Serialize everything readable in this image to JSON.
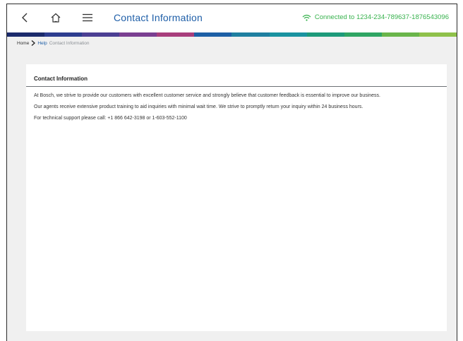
{
  "header": {
    "title": "Contact Information",
    "connection_status": "Connected to 1234-234-789637-1876543096",
    "icons": [
      "back-arrow-icon",
      "home-icon",
      "menu-icon",
      "wifi-icon"
    ]
  },
  "stripe_colors": [
    "#1b2a6b",
    "#2d3d8f",
    "#4b3f93",
    "#7a3f91",
    "#a83e7c",
    "#1d5fa6",
    "#1f7fa0",
    "#1a93a0",
    "#1d9a7a",
    "#2fa563",
    "#6ab54a",
    "#8fc14a"
  ],
  "breadcrumb": {
    "home": "Home",
    "separator": ">",
    "help": "Help",
    "current": "Contact Information"
  },
  "card": {
    "title": "Contact Information",
    "paragraphs": [
      "At Bosch, we strive to provide our customers with excellent customer service and strongly believe that customer feedback is essential to improve our business.",
      "Our agents receive extensive product training to aid inquiries with minimal wait time. We strive to promptly return your inquiry within 24 business hours.",
      "For technical support please call: +1 866 642-3198 or 1-603-552-1100"
    ]
  },
  "colors": {
    "accent_blue": "#1f5fa8",
    "connected_green": "#37b24d",
    "background": "#f0f0f0"
  }
}
